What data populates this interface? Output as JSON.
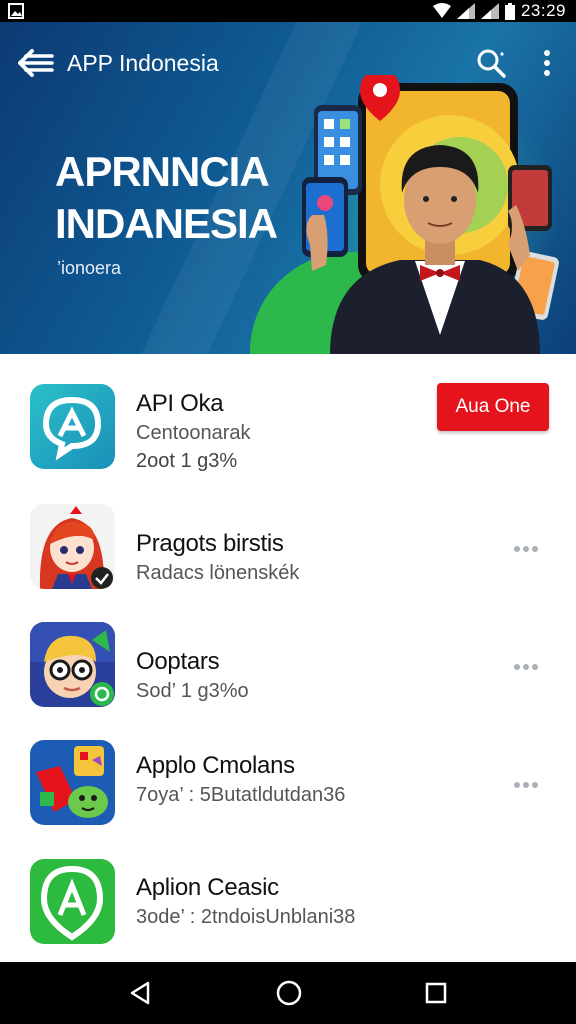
{
  "status_bar": {
    "time": "23:29",
    "icons": [
      "image-icon",
      "wifi-icon",
      "signal-icon",
      "signal-icon",
      "battery-icon"
    ]
  },
  "app_bar": {
    "title": "APP Indonesia",
    "icons": [
      "back-menu-icon",
      "search-icon",
      "more-vert-icon"
    ]
  },
  "hero": {
    "title_line1": "APRNNCIA",
    "title_line2": "INDANESIA",
    "subtitle": "’ionoera"
  },
  "apps": [
    {
      "title": "API Oka",
      "subtitle": "Centoonarak",
      "meta": "2oot 1 g3%",
      "action_label": "Aua One",
      "icon": "chat-a-icon",
      "icon_color": "#1fa9c5"
    },
    {
      "title": "Pragots birstis",
      "subtitle": "Radacs lönenskék",
      "meta": "",
      "action_label": "",
      "icon": "girl-avatar-icon",
      "icon_color": "#f3f3f3"
    },
    {
      "title": "Ooptars",
      "subtitle": "Sod’ 1 g3%o",
      "meta": "",
      "action_label": "",
      "icon": "glasses-character-icon",
      "icon_color": "#2a3f9a"
    },
    {
      "title": "Applo Cmolans",
      "subtitle": "7oya’ : 5Butatldutdan36",
      "meta": "",
      "action_label": "",
      "icon": "game-icon",
      "icon_color": "#1d5cb5"
    },
    {
      "title": "Aplion Ceasic",
      "subtitle": "3ode’ : 2tndoisUnblani38",
      "meta": "",
      "action_label": "",
      "icon": "green-a-icon",
      "icon_color": "#2dbb3f"
    }
  ],
  "nav_bar": {
    "icons": [
      "back-triangle-icon",
      "home-circle-icon",
      "recents-square-icon"
    ]
  },
  "colors": {
    "hero_blue": "#0f5b94",
    "action_red": "#e5141c",
    "status_black": "#000000"
  }
}
